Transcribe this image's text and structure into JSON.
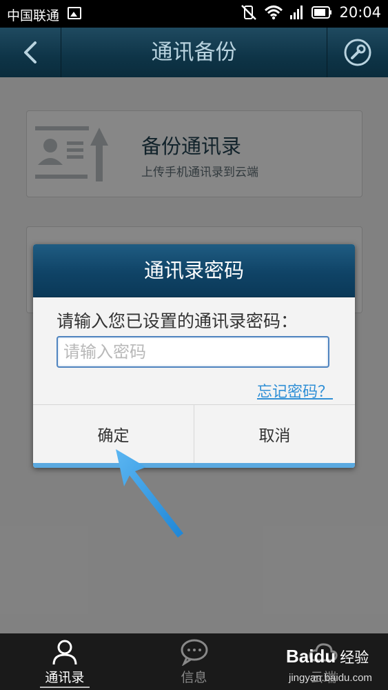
{
  "status_bar": {
    "carrier": "中国联通",
    "time": "20:04"
  },
  "header": {
    "title": "通讯备份",
    "back_icon": "chevron-left-icon",
    "tool_icon": "wrench-icon"
  },
  "cards": [
    {
      "title": "备份通讯录",
      "subtitle": "上传手机通讯录到云端",
      "icon": "contact-upload-icon"
    }
  ],
  "dialog": {
    "title": "通讯录密码",
    "prompt": "请输入您已设置的通讯录密码：",
    "password_placeholder": "请输入密码",
    "password_value": "",
    "forgot_link": "忘记密码？",
    "confirm_label": "确定",
    "cancel_label": "取消"
  },
  "tabs": [
    {
      "label": "通讯录",
      "icon": "person-icon",
      "active": true
    },
    {
      "label": "信息",
      "icon": "chat-bubble-icon",
      "active": false
    },
    {
      "label": "云端",
      "icon": "cloud-icon",
      "active": false
    }
  ],
  "watermark": {
    "brand": "Baidu",
    "brand_cn": "经验",
    "url": "jingyan.baidu.com"
  },
  "colors": {
    "header_bg": "#0e3447",
    "dialog_title_bg": "#0f4366",
    "accent": "#2f8fd6",
    "arrow": "#3a9fe8"
  }
}
